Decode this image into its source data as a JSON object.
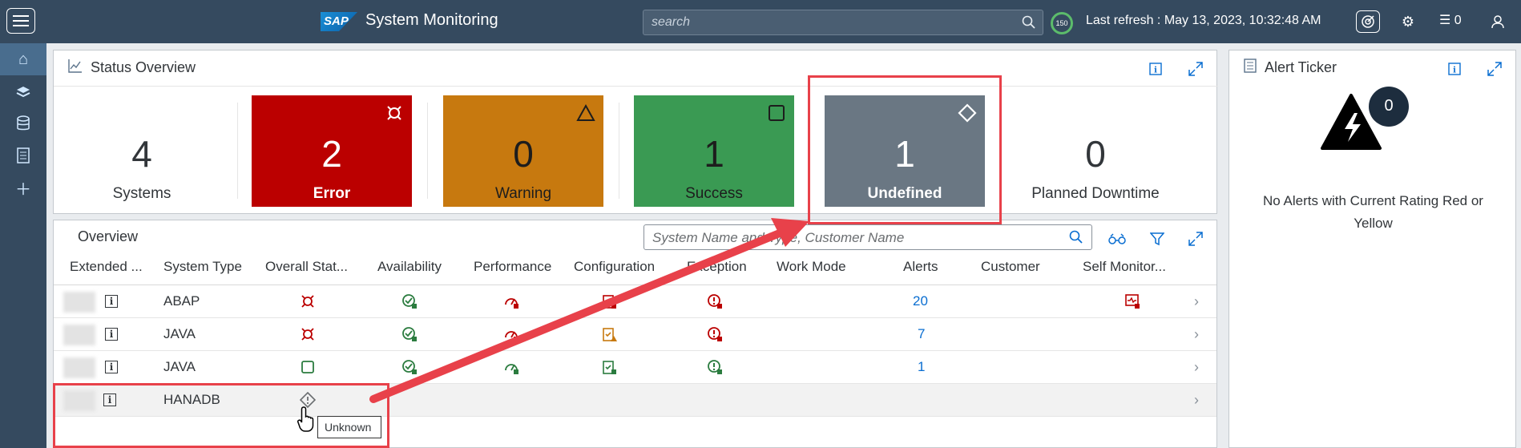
{
  "header": {
    "logo_text": "SAP",
    "title": "System Monitoring",
    "search_placeholder": "search",
    "ring_value": "150",
    "last_refresh": "Last refresh : May 13, 2023, 10:32:48 AM",
    "notification_count": "0"
  },
  "status_overview": {
    "title": "Status Overview",
    "systems": {
      "count": "4",
      "label": "Systems"
    },
    "error": {
      "count": "2",
      "label": "Error",
      "color": "#bb0000"
    },
    "warning": {
      "count": "0",
      "label": "Warning",
      "color": "#c7790f"
    },
    "success": {
      "count": "1",
      "label": "Success",
      "color": "#3a9a53"
    },
    "undefined": {
      "count": "1",
      "label": "Undefined",
      "color": "#6a7783"
    },
    "planned": {
      "count": "0",
      "label": "Planned Downtime"
    }
  },
  "alert_ticker": {
    "title": "Alert Ticker",
    "count": "0",
    "message": "No Alerts with Current Rating Red or Yellow"
  },
  "overview": {
    "title": "Overview",
    "search_placeholder": "System Name and Type, Customer Name",
    "columns": [
      "Extended ...",
      "System Type",
      "Overall Stat...",
      "Availability",
      "Performance",
      "Configuration",
      "Exception",
      "Work Mode",
      "Alerts",
      "Customer",
      "Self Monitor..."
    ],
    "rows": [
      {
        "type": "ABAP",
        "overall": "error",
        "availability": "ok",
        "performance": "error",
        "configuration": "error",
        "exception": "error",
        "alerts": "20",
        "self_monitor": "error"
      },
      {
        "type": "JAVA",
        "overall": "error",
        "availability": "ok",
        "performance": "error",
        "configuration": "warning",
        "exception": "error",
        "alerts": "7",
        "self_monitor": ""
      },
      {
        "type": "JAVA",
        "overall": "success",
        "availability": "ok",
        "performance": "ok",
        "configuration": "ok",
        "exception": "ok",
        "alerts": "1",
        "self_monitor": ""
      },
      {
        "type": "HANADB",
        "overall": "unknown",
        "availability": "",
        "performance": "",
        "configuration": "",
        "exception": "",
        "alerts": "",
        "self_monitor": ""
      }
    ],
    "tooltip": "Unknown"
  },
  "colors": {
    "shell": "#354a5f",
    "link": "#0a6ed1",
    "annotation": "#e8414a"
  }
}
